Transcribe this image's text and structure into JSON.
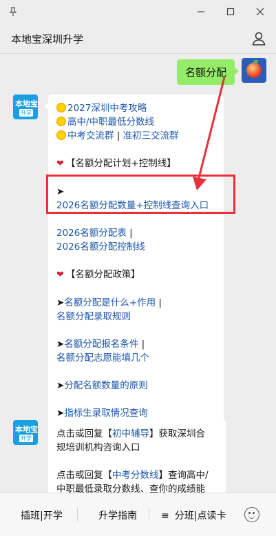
{
  "titlebar": {
    "pin_icon": "pin-icon",
    "minimize_icon": "minimize-icon",
    "maximize_icon": "maximize-icon",
    "close_icon": "close-icon"
  },
  "header": {
    "title": "本地宝深圳升学",
    "user_icon": "user-icon"
  },
  "chat": {
    "outgoing": {
      "text": "名额分配"
    },
    "bot_avatar": {
      "top": "本地宝",
      "bottom": "升学"
    },
    "msg1": {
      "l1": "2027深圳中考攻略",
      "l2": "高中/中职最低分数线",
      "l3a": "中考交流群",
      "l3sep": " | ",
      "l3b": "准初三交流群",
      "s1_heart": "❤",
      "s1_title": "【名额分配计划+控制线】",
      "arrow1": "➤",
      "link1": "2026名额分配数量+控制线查询入口",
      "link2": "2026名额分配表",
      "link2sep": " |",
      "link3": "2026名额分配控制线",
      "s2_heart": "❤",
      "s2_title": "【名额分配政策】",
      "p1_arrow": "➤",
      "p1_a": "名额分配是什么+作用",
      "p1_sep": " |",
      "p1_b": "名额分配录取规则",
      "p2_arrow": "➤",
      "p2_a": "名额分配报名条件",
      "p2_sep": " |",
      "p2_b": "名额分配志愿能填几个",
      "p3_arrow": "➤",
      "p3_a": "分配名额数量的原则",
      "p4_arrow": "➤",
      "p4_a": "指标生录取情况查询"
    },
    "msg2": {
      "a1": "点击或回复【",
      "a_link": "初中辅导",
      "a2": "】获取深圳合",
      "a3": "规培训机构咨询入口",
      "b1": "点击或回复【",
      "b_link": "中考分数线",
      "b2": "】查询高中/",
      "b3": "中职最低录取分数线、查你的成绩能"
    }
  },
  "bottom_menu": {
    "item1": "插班|开学",
    "item2": "升学指南",
    "item3_icon": "≡",
    "item3": "分班|点读卡",
    "emoji_icon": "emoji-icon"
  },
  "colors": {
    "background": "#ededed",
    "bubble_out": "#95ec69",
    "link": "#1c56a8",
    "highlight": "#e8303a"
  }
}
